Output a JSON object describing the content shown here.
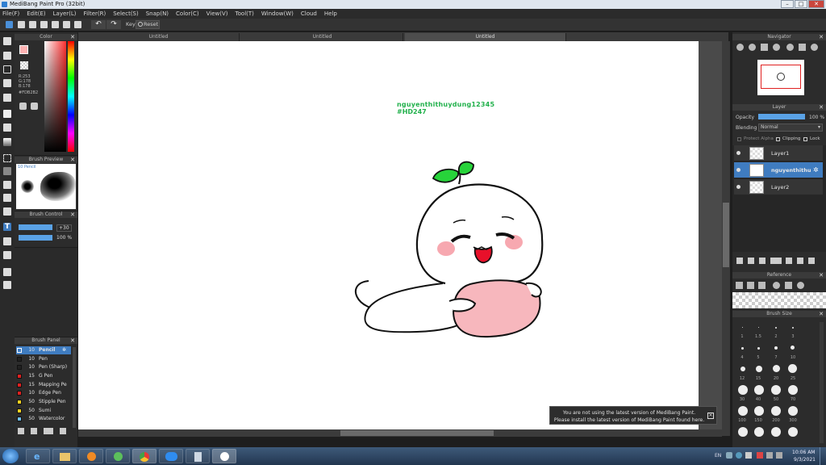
{
  "window": {
    "title": "MediBang Paint Pro (32bit)"
  },
  "menu": [
    "File(F)",
    "Edit(E)",
    "Layer(L)",
    "Filter(R)",
    "Select(S)",
    "Snap(N)",
    "Color(C)",
    "View(V)",
    "Tool(T)",
    "Window(W)",
    "Cloud",
    "Help"
  ],
  "toolbar": {
    "key_label": "Key",
    "reset_label": "Reset"
  },
  "tabs": [
    "Untitled",
    "Untitled",
    "Untitled"
  ],
  "color_panel": {
    "title": "Color",
    "r": "R:253",
    "g": "G:178",
    "b": "B:178",
    "hex": "#FDB2B2",
    "fg_color": "#FDB2B2"
  },
  "brush_preview": {
    "title": "Brush Preview",
    "brush_name": "10 Pencil"
  },
  "brush_control": {
    "title": "Brush Control",
    "size_value": "+30",
    "opacity_value": "100 %"
  },
  "brush_panel": {
    "title": "Brush Panel",
    "items": [
      {
        "size": "10",
        "name": "Pencil",
        "color": "#3f7cc0"
      },
      {
        "size": "10",
        "name": "Pen",
        "color": "#222222"
      },
      {
        "size": "10",
        "name": "Pen (Sharp)",
        "color": "#222222"
      },
      {
        "size": "15",
        "name": "G Pen",
        "color": "#e02020"
      },
      {
        "size": "15",
        "name": "Mapping Pe",
        "color": "#e02020"
      },
      {
        "size": "10",
        "name": "Edge Pen",
        "color": "#e02020"
      },
      {
        "size": "50",
        "name": "Stipple Pen",
        "color": "#f0d020"
      },
      {
        "size": "50",
        "name": "Sumi",
        "color": "#f0d020"
      },
      {
        "size": "50",
        "name": "Watercolor",
        "color": "#70c0f0"
      }
    ]
  },
  "canvas": {
    "watermark_line1": "nguyenthithuydung12345",
    "watermark_line2": "#HD247"
  },
  "notice": {
    "line1": "You are not using the latest version of MediBang Paint.",
    "line2": "Please install the latest version of MediBang Paint found here."
  },
  "navigator": {
    "title": "Navigator"
  },
  "layer_panel": {
    "title": "Layer",
    "opacity_label": "Opacity",
    "opacity_value": "100 %",
    "blending_label": "Blending",
    "blending_value": "Normal",
    "protect_alpha": "Protect Alpha",
    "clipping": "Clipping",
    "lock": "Lock",
    "layers": [
      "Layer1",
      "nguyenthithu",
      "Layer2"
    ]
  },
  "reference": {
    "title": "Reference"
  },
  "brush_size": {
    "title": "Brush Size",
    "labels": [
      "1",
      "1.5",
      "2",
      "3",
      "4",
      "5",
      "7",
      "10",
      "12",
      "15",
      "20",
      "25",
      "30",
      "40",
      "50",
      "70",
      "100",
      "150",
      "200",
      "300"
    ]
  },
  "taskbar": {
    "lang": "EN",
    "time": "10:06 AM",
    "date": "9/3/2021"
  }
}
